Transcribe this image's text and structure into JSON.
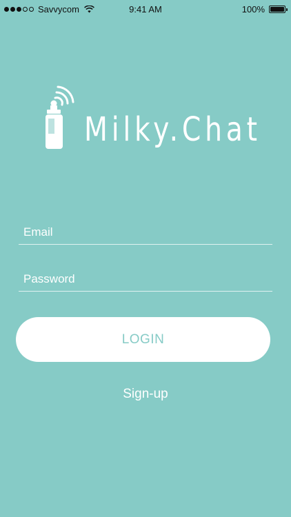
{
  "status_bar": {
    "carrier": "Savvycom",
    "time": "9:41 AM",
    "battery_percent": "100%",
    "battery_level": 1.0,
    "signal_bars": 5,
    "signal_filled": 3
  },
  "logo": {
    "text": "Milky.Chat",
    "icon": "baby-bottle-wifi-icon"
  },
  "form": {
    "email_placeholder": "Email",
    "email_value": "",
    "password_placeholder": "Password",
    "password_value": ""
  },
  "actions": {
    "login_label": "LOGIN",
    "signup_label": "Sign-up"
  },
  "colors": {
    "background": "#86CBC6",
    "button_bg": "#ffffff",
    "button_text": "#86CBC6",
    "text": "#ffffff"
  }
}
